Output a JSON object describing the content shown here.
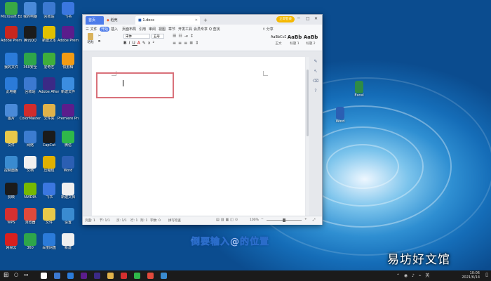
{
  "desktop": {
    "icons": [
      {
        "label": "Microsoft Edge",
        "color": "#3aa845"
      },
      {
        "label": "我的电脑",
        "color": "#4a8ad8"
      },
      {
        "label": "回收站",
        "color": "#3c79d0"
      },
      {
        "label": "飞书",
        "color": "#3b77e0"
      },
      {
        "label": "Adobe Premiere",
        "color": "#c9261e"
      },
      {
        "label": "腾讯QQ",
        "color": "#1b1b1b"
      },
      {
        "label": "新建文本",
        "color": "#e0c000"
      },
      {
        "label": "Adobe Premiere Pro",
        "color": "#5b1d8c"
      },
      {
        "label": "我的文件",
        "color": "#2b7bd9"
      },
      {
        "label": "360安全",
        "color": "#2ea64a"
      },
      {
        "label": "爱奇艺",
        "color": "#3fae3b"
      },
      {
        "label": "快剪辑",
        "color": "#f29b14"
      },
      {
        "label": "此电脑",
        "color": "#2b7bd9"
      },
      {
        "label": "回收站",
        "color": "#3c79d0"
      },
      {
        "label": "Adobe After Effects",
        "color": "#3b2a86"
      },
      {
        "label": "新建文件",
        "color": "#3c8de0"
      },
      {
        "label": "图片",
        "color": "#4a8ad8"
      },
      {
        "label": "ColorMaster",
        "color": "#d12c2c"
      },
      {
        "label": "文件夹",
        "color": "#e0b24a"
      },
      {
        "label": "Premiere Pro",
        "color": "#5b1d8c"
      },
      {
        "label": "文件",
        "color": "#e8c84a"
      },
      {
        "label": "网络",
        "color": "#3c7cd0"
      },
      {
        "label": "CapCut",
        "color": "#1b1b1b"
      },
      {
        "label": "微信",
        "color": "#2fb84a"
      },
      {
        "label": "控制面板",
        "color": "#3a8bd0"
      },
      {
        "label": "文档",
        "color": "#f0f0f0"
      },
      {
        "label": "压缩包",
        "color": "#e0b000"
      },
      {
        "label": "Word",
        "color": "#2b5fb3"
      },
      {
        "label": "剪映",
        "color": "#1b1b1b"
      },
      {
        "label": "NVIDIA",
        "color": "#76b900"
      },
      {
        "label": "飞书",
        "color": "#3b77e0"
      },
      {
        "label": "新建文档",
        "color": "#f0f0f0"
      },
      {
        "label": "WPS",
        "color": "#d53030"
      },
      {
        "label": "浏览器",
        "color": "#e14a3c"
      },
      {
        "label": "文件",
        "color": "#e8c84a"
      },
      {
        "label": "设置",
        "color": "#3a8bd0"
      },
      {
        "label": "网易云",
        "color": "#d8201f"
      },
      {
        "label": "360",
        "color": "#2ea64a"
      },
      {
        "label": "百度网盘",
        "color": "#2b7bd9"
      },
      {
        "label": "新建",
        "color": "#f0f0f0"
      }
    ],
    "right_icons": [
      {
        "label": "Excel",
        "color": "#2e8b46"
      },
      {
        "label": "Word",
        "color": "#2b5fb3"
      }
    ]
  },
  "window": {
    "tabs": [
      {
        "label": "首页"
      },
      {
        "label": "稻壳"
      },
      {
        "label": "1.docx"
      }
    ],
    "add_tab": "+",
    "login_badge": "立即登录",
    "menus": [
      "三 文件",
      "开始",
      "插入",
      "页面布局",
      "引用",
      "审阅",
      "视图",
      "章节",
      "开发工具",
      "会员专享",
      "Q 查找"
    ],
    "share": "分享",
    "ribbon_styles": [
      {
        "sample": "AaBbCcDd",
        "name": "正文"
      },
      {
        "sample": "AaBb",
        "name": "标题 1"
      },
      {
        "sample": "AaBb",
        "name": "标题 2"
      }
    ],
    "paste_label": "粘贴",
    "font_name": "宋体",
    "font_size": "五号",
    "status": {
      "page": "页面: 1",
      "section": "节: 1/1",
      "page_of": "页: 1/1",
      "row": "行: 1",
      "col": "列: 1",
      "words": "字数: 0",
      "spell": "拼写检查",
      "zoom": "100%"
    }
  },
  "subtitle": "倒要输入@的位置",
  "watermark": "易坊好文馆",
  "taskbar": {
    "time": "10:06",
    "date": "2021/6/14",
    "apps": [
      "#ffffff",
      "#3c79d0",
      "#2b7bd9",
      "#5b1d8c",
      "#3b2a86",
      "#e0b24a",
      "#d53030",
      "#2fb84a",
      "#e14a3c",
      "#3a8bd0"
    ]
  }
}
